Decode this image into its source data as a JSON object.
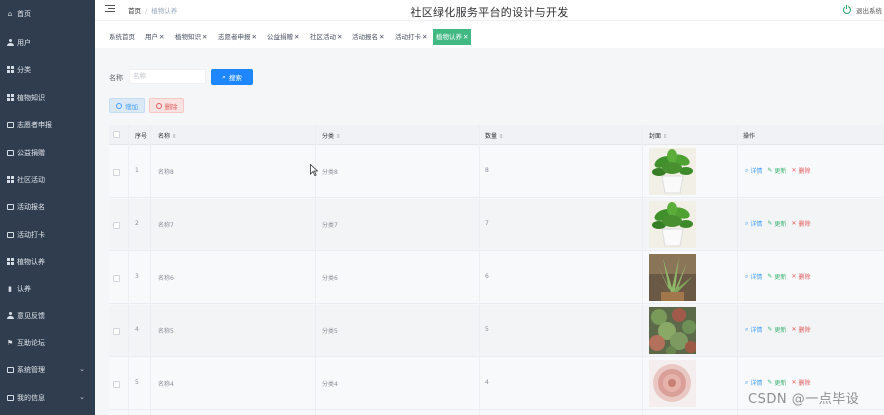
{
  "sidebar": {
    "items": [
      {
        "label": "首页",
        "icon": "home-icon"
      },
      {
        "label": "用户",
        "icon": "user-icon"
      },
      {
        "label": "分类",
        "icon": "grid-icon"
      },
      {
        "label": "植物知识",
        "icon": "grid-icon"
      },
      {
        "label": "志愿者申报",
        "icon": "box-icon"
      },
      {
        "label": "公益捐赠",
        "icon": "box-icon"
      },
      {
        "label": "社区活动",
        "icon": "grid-icon"
      },
      {
        "label": "活动报名",
        "icon": "box-icon"
      },
      {
        "label": "活动打卡",
        "icon": "box-icon"
      },
      {
        "label": "植物认养",
        "icon": "grid-icon"
      },
      {
        "label": "认养",
        "icon": "bar-chart-icon"
      },
      {
        "label": "意见反馈",
        "icon": "user-icon"
      },
      {
        "label": "互助论坛",
        "icon": "flag-icon"
      },
      {
        "label": "系统管理",
        "icon": "box-icon",
        "expandable": true
      },
      {
        "label": "我的信息",
        "icon": "box-icon",
        "expandable": true
      }
    ]
  },
  "header": {
    "breadcrumb_home": "首页",
    "breadcrumb_current": "植物认养",
    "title": "社区绿化服务平台的设计与开发",
    "logout_label": "退出系统"
  },
  "tags": [
    {
      "label": "系统首页",
      "closable": false,
      "active": false
    },
    {
      "label": "用户",
      "closable": true,
      "active": false
    },
    {
      "label": "植物知识",
      "closable": true,
      "active": false
    },
    {
      "label": "志愿者申报",
      "closable": true,
      "active": false
    },
    {
      "label": "公益捐赠",
      "closable": true,
      "active": false
    },
    {
      "label": "社区活动",
      "closable": true,
      "active": false
    },
    {
      "label": "活动报名",
      "closable": true,
      "active": false
    },
    {
      "label": "活动打卡",
      "closable": true,
      "active": false
    },
    {
      "label": "植物认养",
      "closable": true,
      "active": true
    }
  ],
  "search": {
    "label": "名称",
    "placeholder": "名称",
    "button_label": "搜索"
  },
  "actions": {
    "add_label": "增加",
    "delete_label": "删除"
  },
  "table": {
    "columns": [
      "序号",
      "名称",
      "分类",
      "数量",
      "封面",
      "操作"
    ],
    "rows": [
      {
        "index": "1",
        "name": "名称8",
        "category": "分类8",
        "quantity": "8",
        "cover": "potted-green-plant"
      },
      {
        "index": "2",
        "name": "名称7",
        "category": "分类7",
        "quantity": "7",
        "cover": "potted-green-plant"
      },
      {
        "index": "3",
        "name": "名称6",
        "category": "分类6",
        "quantity": "6",
        "cover": "succulent-plant"
      },
      {
        "index": "4",
        "name": "名称5",
        "category": "分类5",
        "quantity": "5",
        "cover": "succulent-garden"
      },
      {
        "index": "5",
        "name": "名称4",
        "category": "分类4",
        "quantity": "4",
        "cover": "pink-succulent"
      }
    ],
    "row_actions": {
      "detail": "详情",
      "update": "更新",
      "delete": "删除"
    }
  },
  "watermark": "CSDN @一点毕设",
  "colors": {
    "sidebar_bg": "#2f3d4e",
    "active_tag": "#42b983",
    "primary": "#1e87ff",
    "danger": "#e05a5a",
    "success": "#3bb272"
  }
}
